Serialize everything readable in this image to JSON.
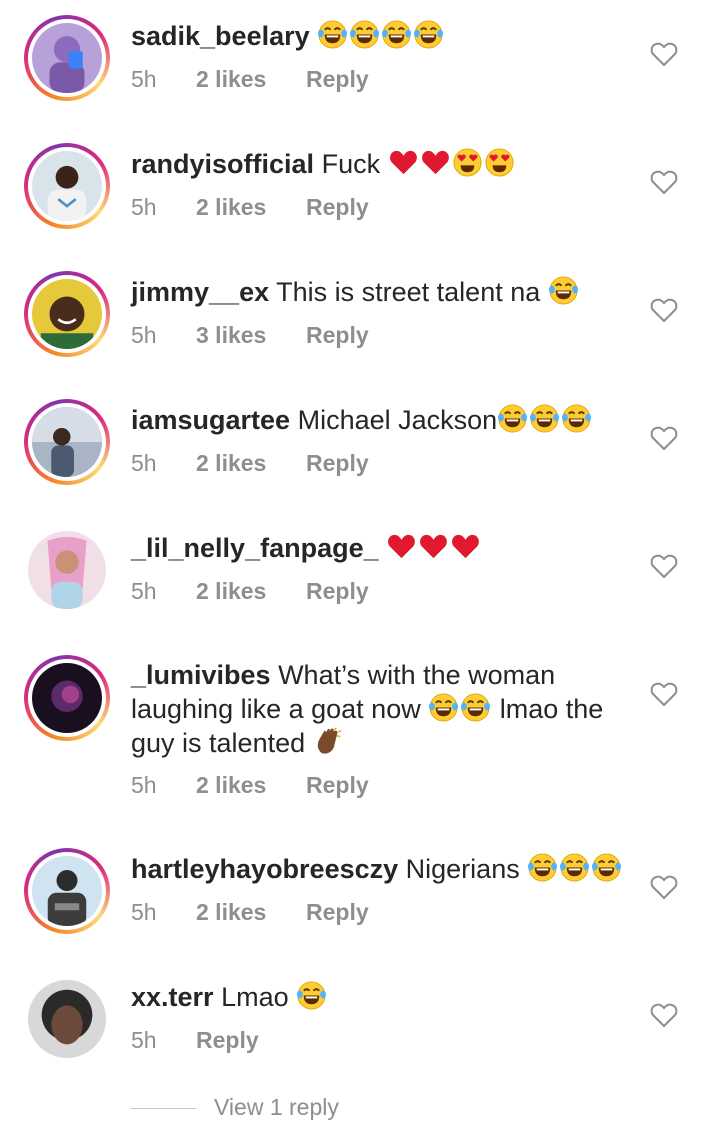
{
  "meta_labels": {
    "reply": "Reply"
  },
  "comments": [
    {
      "username": "sadik_beelary",
      "text": "",
      "time": "5h",
      "likes": "2 likes"
    },
    {
      "username": "randyisofficial",
      "text": "Fuck",
      "time": "5h",
      "likes": "2 likes"
    },
    {
      "username": "jimmy__ex",
      "text": "This is street talent na",
      "time": "5h",
      "likes": "3 likes"
    },
    {
      "username": "iamsugartee",
      "text": "Michael Jackson",
      "time": "5h",
      "likes": "2 likes"
    },
    {
      "username": "_lil_nelly_fanpage_",
      "text": "",
      "time": "5h",
      "likes": "2 likes"
    },
    {
      "username": "_lumivibes",
      "text_line1": "What’s with the woman",
      "text_line2a": "laughing like a goat now",
      "text_line2b": "lmao the",
      "text_line3": "guy is talented",
      "time": "5h",
      "likes": "2 likes"
    },
    {
      "username": "hartleyhayobreesczy",
      "text": "Nigerians",
      "time": "5h",
      "likes": "2 likes"
    },
    {
      "username": "xx.terr",
      "text": "Lmao",
      "time": "5h"
    }
  ],
  "view_replies": "View 1 reply",
  "icons": {
    "like": "heart-outline-icon",
    "joy": "face-with-tears-of-joy-emoji",
    "heart": "red-heart-emoji",
    "heart_eyes": "heart-eyes-emoji",
    "clap": "clapping-hands-emoji"
  },
  "colors": {
    "text": "#262626",
    "muted": "#8e8e8e",
    "story_ring": "#dd2a7b"
  }
}
